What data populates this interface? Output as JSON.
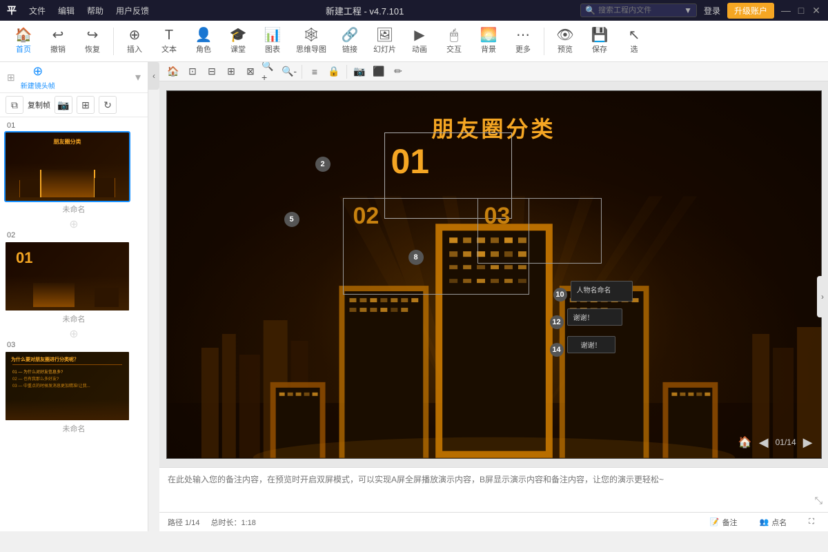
{
  "titlebar": {
    "menus": [
      "平",
      "文件",
      "编辑",
      "帮助",
      "用户反馈"
    ],
    "title": "新建工程 - v4.7.101",
    "search_placeholder": "搜索工程内文件",
    "login_label": "登录",
    "upgrade_label": "升级账户",
    "win_min": "—",
    "win_max": "□",
    "win_close": "✕"
  },
  "toolbar": {
    "home_label": "首页",
    "undo_label": "撤销",
    "redo_label": "恢复",
    "insert_label": "插入",
    "text_label": "文本",
    "character_label": "角色",
    "classroom_label": "课堂",
    "chart_label": "图表",
    "mindmap_label": "思维导图",
    "link_label": "链接",
    "slide_label": "幻灯片",
    "animation_label": "动画",
    "interact_label": "交互",
    "bg_label": "背景",
    "more_label": "更多",
    "preview_label": "预览",
    "save_label": "保存",
    "select_label": "选"
  },
  "panel": {
    "new_frame_label": "新建镜头帧",
    "copy_frame_label": "复制帧",
    "tools": [
      "复制帧",
      "📷",
      "⊞",
      "⟳"
    ]
  },
  "slides": [
    {
      "number": "01",
      "name": "未命名",
      "active": true
    },
    {
      "number": "02",
      "name": "未命名",
      "active": false
    },
    {
      "number": "03",
      "name": "未命名",
      "active": false
    }
  ],
  "canvas": {
    "title": "朋友圈分类",
    "number_01": "01",
    "number_02": "02",
    "number_03": "03",
    "nodes": [
      "2",
      "5",
      "8",
      "10",
      "12",
      "14"
    ],
    "info_10": "人物名命名",
    "info_12": "谢谢！",
    "info_14": "谢谢！"
  },
  "navigation": {
    "page_info": "01/14",
    "total_duration": "总时长：1:18",
    "path_info": "路径 1/14"
  },
  "notes": {
    "placeholder": "在此处输入您的备注内容，在预览时开启双屏模式，可以实现A屏全屏播放演示内容，B屏显示演示内容和备注内容，让您的演示更轻松~"
  },
  "statusbar": {
    "path_label": "路径 1/14",
    "duration_label": "总时长：1:18",
    "notes_label": "备注",
    "dot_label": "点名"
  }
}
